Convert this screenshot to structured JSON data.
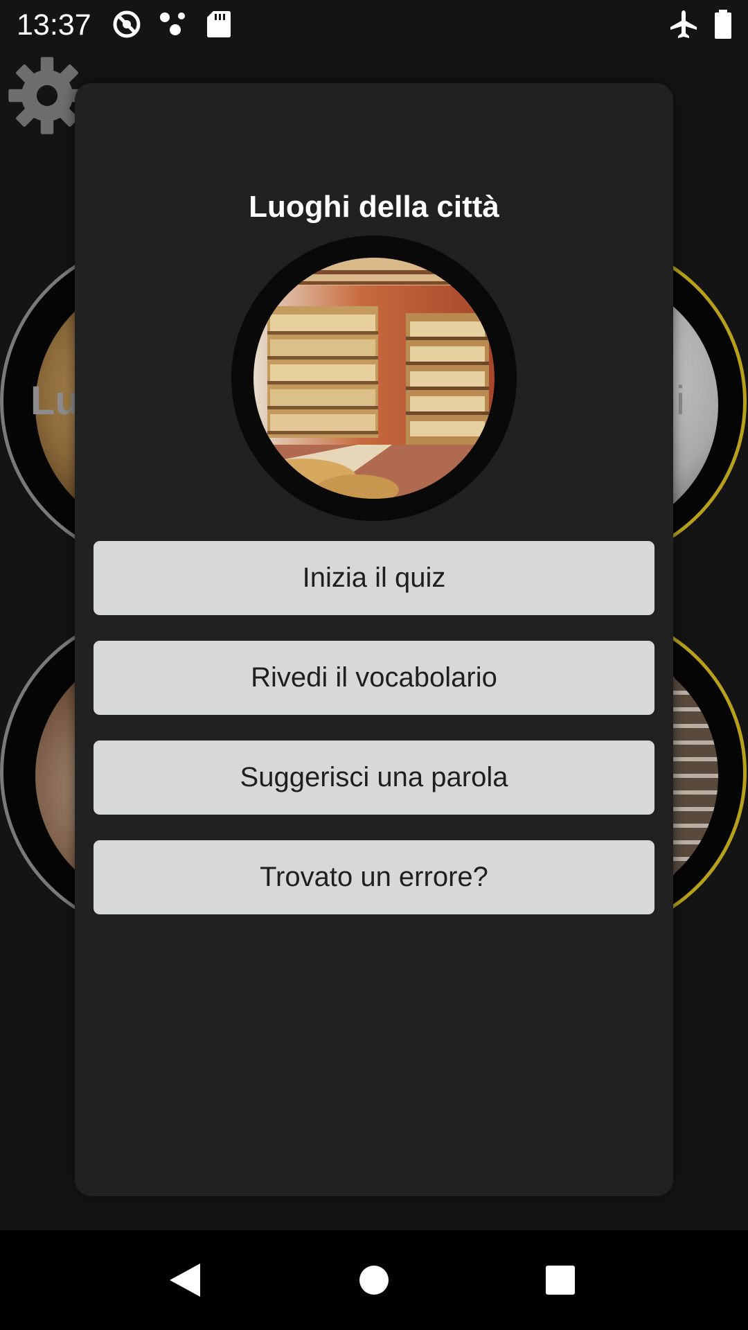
{
  "status_bar": {
    "time": "13:37",
    "icons": [
      "data-saver-icon",
      "assistant-dots-icon",
      "sd-card-icon",
      "airplane-mode-icon",
      "battery-icon"
    ]
  },
  "background": {
    "settings_icon": "gear-icon",
    "card_labels": [
      "Lu",
      "i"
    ]
  },
  "dialog": {
    "title": "Luoghi della città",
    "image": "bakery-shop-interior",
    "buttons": [
      {
        "label": "Inizia il quiz"
      },
      {
        "label": "Rivedi il vocabolario"
      },
      {
        "label": "Suggerisci una parola"
      },
      {
        "label": "Trovato un errore?"
      }
    ]
  },
  "nav_bar": {
    "icons": [
      "back-icon",
      "home-icon",
      "recents-icon"
    ]
  },
  "colors": {
    "dialog_bg": "#212121",
    "button_bg": "#d7d8d8",
    "ring_gray": "#7a7a7a",
    "ring_gold": "#b7a11a"
  }
}
